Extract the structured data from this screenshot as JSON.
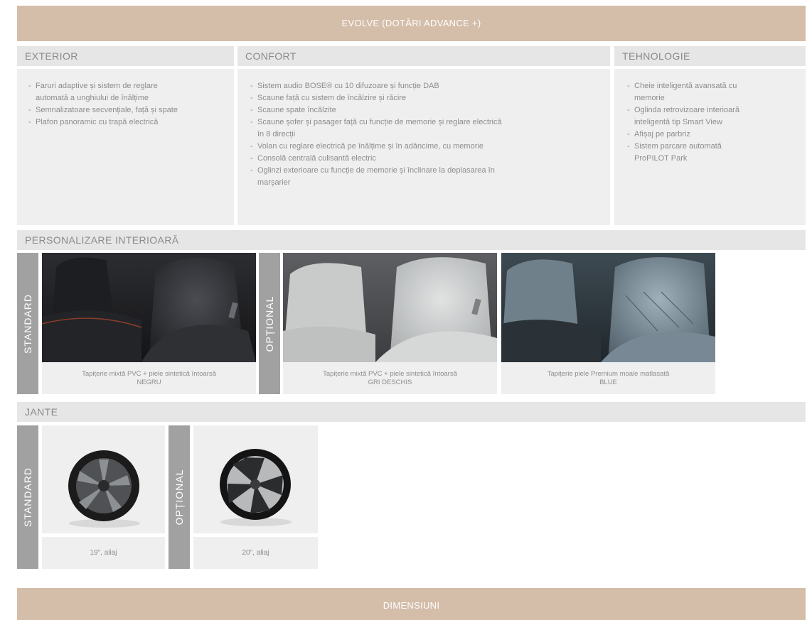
{
  "header": {
    "title": "EVOLVE (DOTĂRI ADVANCE +)"
  },
  "exterior": {
    "title": "EXTERIOR",
    "items": [
      [
        "Faruri adaptive și sistem de reglare",
        "automată a unghiului de înălțime"
      ],
      [
        "Semnalizatoare secvențiale, față și spate"
      ],
      [
        "Plafon panoramic cu trapă electrică"
      ]
    ]
  },
  "confort": {
    "title": "CONFORT",
    "items": [
      [
        "Sistem audio BOSE® cu 10 difuzoare și funcție DAB"
      ],
      [
        "Scaune față cu sistem de încălzire și răcire"
      ],
      [
        "Scaune spate încălzite"
      ],
      [
        "Scaune șofer și pasager față cu funcție de memorie și reglare electrică",
        "în 8 direcții"
      ],
      [
        "Volan cu reglare electrică pe înălțime și în adâncime, cu memorie"
      ],
      [
        "Consolă centrală culisantă electric"
      ],
      [
        "Oglinzi exterioare cu funcție de memorie și înclinare la deplasarea în",
        "marșarier"
      ]
    ]
  },
  "tehnologie": {
    "title": "TEHNOLOGIE",
    "items": [
      [
        "Cheie inteligentă avansată cu",
        "memorie"
      ],
      [
        "Oglinda retrovizoare interioară",
        "inteligentă tip Smart View"
      ],
      [
        "Afișaj pe parbriz"
      ],
      [
        "Sistem parcare automată",
        "ProPILOT Park"
      ]
    ]
  },
  "interior": {
    "title": "PERSONALIZARE INTERIOARĂ",
    "standard_label": "STANDARD",
    "optional_label": "OPȚIONAL",
    "options": [
      {
        "line1": "Tapițerie mixtă PVC + piele sintetică întoarsă",
        "line2": "NEGRU"
      },
      {
        "line1": "Tapițerie mixtă PVC + piele sintetică întoarsă",
        "line2": "GRI DESCHIS"
      },
      {
        "line1": "Tapițerie piele Premium moale matlasată",
        "line2": "BLUE"
      }
    ]
  },
  "jante": {
    "title": "JANTE",
    "standard_label": "STANDARD",
    "optional_label": "OPȚIONAL",
    "options": [
      {
        "label": "19\", aliaj"
      },
      {
        "label": "20\", aliaj"
      }
    ]
  },
  "footer": {
    "title": "DIMENSIUNI"
  }
}
